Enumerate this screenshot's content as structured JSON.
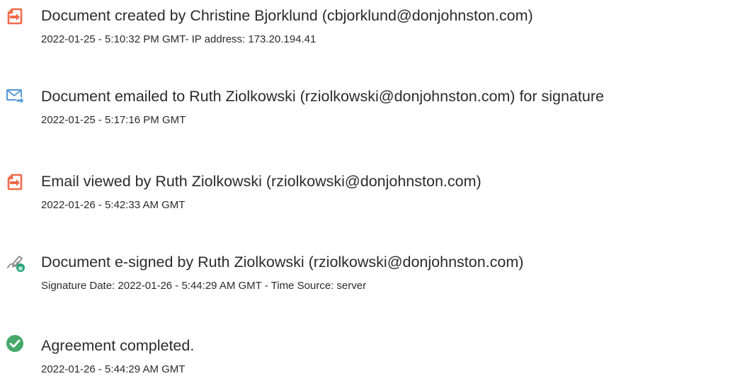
{
  "events": [
    {
      "icon": "document-created-icon",
      "title": "Document created by Christine Bjorklund (cbjorklund@donjohnston.com)",
      "detail": "2022-01-25 - 5:10:32 PM GMT- IP address: 173.20.194.41"
    },
    {
      "icon": "email-sent-icon",
      "title": "Document emailed to Ruth Ziolkowski (rziolkowski@donjohnston.com) for signature",
      "detail": "2022-01-25 - 5:17:16 PM GMT"
    },
    {
      "icon": "document-viewed-icon",
      "title": "Email viewed by Ruth Ziolkowski (rziolkowski@donjohnston.com)",
      "detail": "2022-01-26 - 5:42:33 AM GMT"
    },
    {
      "icon": "e-sign-pen-icon",
      "title": "Document e-signed by Ruth Ziolkowski (rziolkowski@donjohnston.com)",
      "detail": "Signature Date: 2022-01-26 - 5:44:29 AM GMT - Time Source: server"
    },
    {
      "icon": "checkmark-circle-icon",
      "title": "Agreement completed.",
      "detail": "2022-01-26 - 5:44:29 AM GMT"
    }
  ],
  "colors": {
    "document_icon": "#f06b4a",
    "email_icon": "#5b9bd5",
    "complete_icon": "#46a86b",
    "sign_badge": "#25a87b",
    "text": "#2b2b2b"
  }
}
